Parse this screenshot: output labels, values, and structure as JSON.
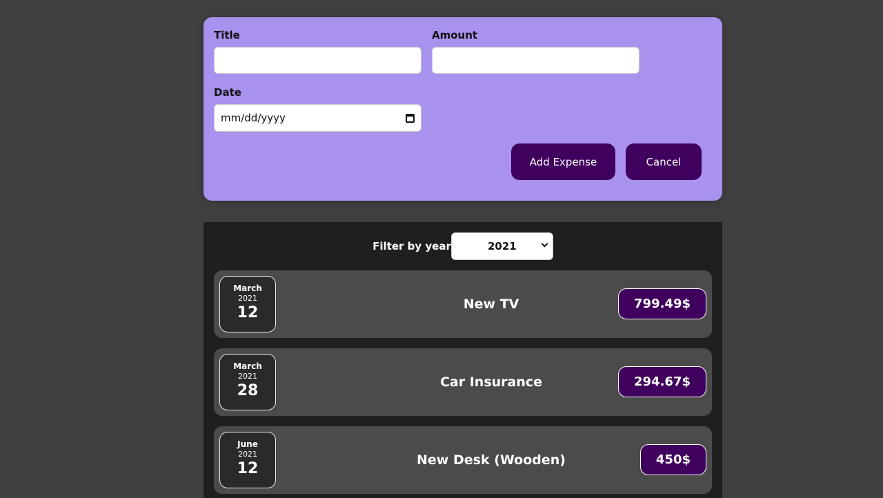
{
  "form": {
    "title_label": "Title",
    "title_value": "",
    "amount_label": "Amount",
    "amount_value": "",
    "date_label": "Date",
    "date_placeholder": "mm/dd/yyyy",
    "add_button": "Add Expense",
    "cancel_button": "Cancel"
  },
  "filter": {
    "label": "Filter by year",
    "selected_year": "2021"
  },
  "expenses": [
    {
      "month": "March",
      "year": "2021",
      "day": "12",
      "title": "New TV",
      "amount": "799.49$"
    },
    {
      "month": "March",
      "year": "2021",
      "day": "28",
      "title": "Car Insurance",
      "amount": "294.67$"
    },
    {
      "month": "June",
      "year": "2021",
      "day": "12",
      "title": "New Desk (Wooden)",
      "amount": "450$"
    }
  ],
  "colors": {
    "form_background": "#a892ee",
    "button": "#40005d",
    "list_background": "#1f1f1f",
    "item_background": "#4b4b4b"
  }
}
